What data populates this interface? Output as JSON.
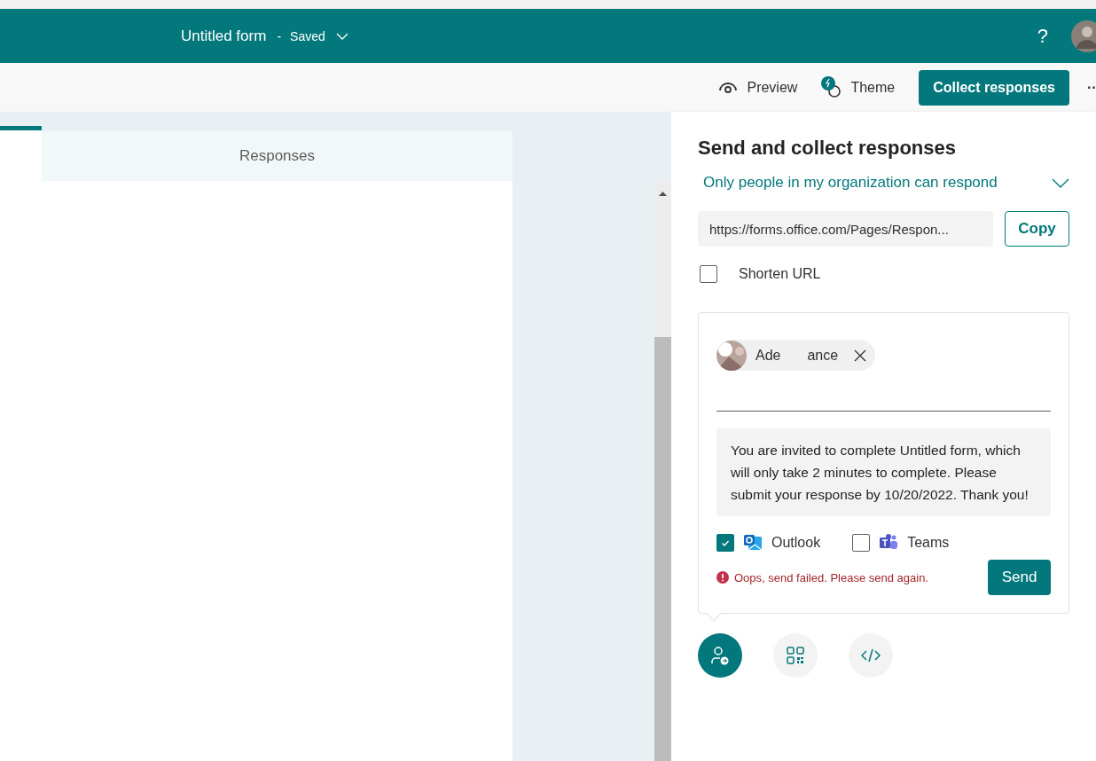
{
  "header": {
    "title": "Untitled form",
    "separator": "-",
    "status": "Saved"
  },
  "toolbar": {
    "help": "?",
    "actions": [
      {
        "kind": "preview",
        "label": "Preview"
      },
      {
        "kind": "theme",
        "label": "Theme"
      }
    ],
    "primary": "Collect responses",
    "more": "··"
  },
  "tabs": [
    {
      "label": "Responses",
      "selected": false
    }
  ],
  "panel": {
    "title": "Send and collect responses",
    "audience": "Only people in my organization can respond",
    "url": "https://forms.office.com/Pages/Respon...",
    "copy": "Copy",
    "shorten": {
      "label": "Shorten URL",
      "checked": false
    },
    "recipient": {
      "name_parts": [
        "Ade",
        "ance"
      ]
    },
    "message": "You are invited to complete Untitled form, which will only take 2 minutes to complete. Please submit your response by 10/20/2022. Thank you!",
    "channels": [
      {
        "kind": "outlook",
        "label": "Outlook",
        "checked": true
      },
      {
        "kind": "teams",
        "label": "Teams",
        "checked": false
      }
    ],
    "error": "Oops, send failed. Please send again.",
    "send": "Send",
    "modes": [
      {
        "kind": "share",
        "selected": true
      },
      {
        "kind": "qr",
        "selected": false
      },
      {
        "kind": "embed",
        "selected": false
      }
    ]
  }
}
